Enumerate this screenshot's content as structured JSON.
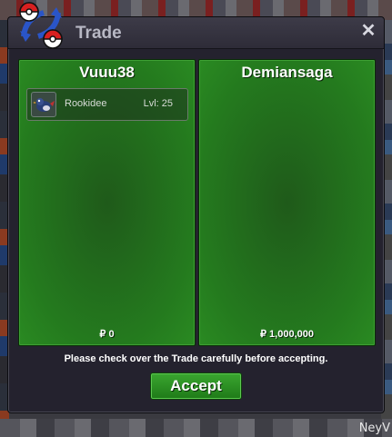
{
  "window": {
    "title": "Trade",
    "close_label": "✕"
  },
  "left_panel": {
    "trainer": "Vuuu38",
    "items": [
      {
        "name": "Rookidee",
        "level": "Lvl: 25",
        "icon": "rookidee-sprite-icon"
      }
    ],
    "money": "₽ 0"
  },
  "right_panel": {
    "trainer": "Demiansaga",
    "items": [],
    "money": "₽ 1,000,000"
  },
  "notice": "Please check over the Trade carefully before accepting.",
  "accept_label": "Accept",
  "world_text": "NeyV",
  "colors": {
    "panel_green": "#247a1e",
    "window_bg": "#24222e",
    "title_text": "#b8b8c4",
    "accept_green": "#2e9426"
  }
}
